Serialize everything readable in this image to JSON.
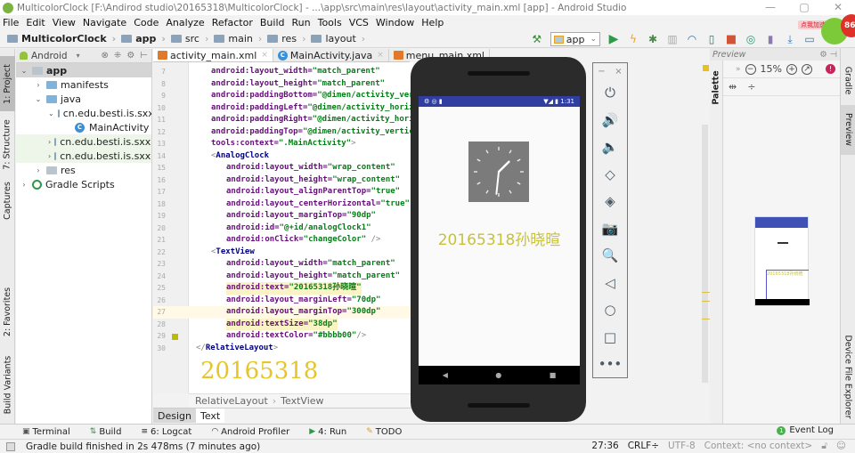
{
  "window": {
    "title": "MulticolorClock [F:\\Andirod studio\\20165318\\MulticolorClock] - ...\\app\\src\\main\\res\\layout\\activity_main.xml [app] - Android Studio",
    "controls": [
      "—",
      "▢",
      "✕"
    ]
  },
  "menu": [
    "File",
    "Edit",
    "View",
    "Navigate",
    "Code",
    "Analyze",
    "Refactor",
    "Build",
    "Run",
    "Tools",
    "VCS",
    "Window",
    "Help"
  ],
  "breadcrumb": [
    "MulticolorClock",
    "app",
    "src",
    "main",
    "res",
    "layout"
  ],
  "toolbar": {
    "run_config": "app",
    "speed_tag": "点我加速",
    "badge": "86",
    "icons": [
      "hammer-icon",
      "run-icon",
      "apply-changes-icon",
      "debug-icon",
      "attach-icon",
      "profiler-icon",
      "attach-debugger-icon",
      "stop-icon",
      "sync-icon",
      "avd-manager-icon",
      "sdk-manager-icon",
      "device-icon"
    ]
  },
  "left_strip": {
    "tabs": [
      "1: Project",
      "7: Structure",
      "Captures",
      "2: Favorites",
      "Build Variants"
    ]
  },
  "project": {
    "view_mode": "Android",
    "tree": [
      {
        "label": "app",
        "level": 0,
        "expanded": true,
        "type": "module",
        "selected": true
      },
      {
        "label": "manifests",
        "level": 1,
        "expanded": false,
        "type": "folder"
      },
      {
        "label": "java",
        "level": 1,
        "expanded": true,
        "type": "folder"
      },
      {
        "label": "cn.edu.besti.is.sxx.mu",
        "level": 2,
        "expanded": true,
        "type": "package"
      },
      {
        "label": "MainActivity",
        "level": 3,
        "type": "class"
      },
      {
        "label": "cn.edu.besti.is.sxx.mu",
        "level": 2,
        "expanded": false,
        "type": "package",
        "highlight": true
      },
      {
        "label": "cn.edu.besti.is.sxx.mu",
        "level": 2,
        "expanded": false,
        "type": "package",
        "highlight": true
      },
      {
        "label": "res",
        "level": 1,
        "expanded": false,
        "type": "res"
      },
      {
        "label": "Gradle Scripts",
        "level": 0,
        "expanded": false,
        "type": "gradle"
      }
    ]
  },
  "editor": {
    "tabs": [
      {
        "label": "activity_main.xml",
        "icon": "xml",
        "active": true
      },
      {
        "label": "MainActivity.java",
        "icon": "class",
        "active": false
      },
      {
        "label": "menu_main.xml",
        "icon": "xml",
        "active": false
      }
    ],
    "lines": [
      {
        "n": "7",
        "indent": 1,
        "parts": [
          [
            "attr",
            "android:layout_width="
          ],
          [
            "val",
            "\"match_parent\""
          ]
        ]
      },
      {
        "n": "8",
        "indent": 1,
        "parts": [
          [
            "attr",
            "android:layout_height="
          ],
          [
            "val",
            "\"match_parent\""
          ]
        ]
      },
      {
        "n": "9",
        "indent": 1,
        "parts": [
          [
            "attr",
            "android:paddingBottom="
          ],
          [
            "val",
            "\"@dimen/activity_vertic"
          ]
        ]
      },
      {
        "n": "10",
        "indent": 1,
        "parts": [
          [
            "attr",
            "android:paddingLeft="
          ],
          [
            "val",
            "\"@dimen/activity_horizont"
          ]
        ]
      },
      {
        "n": "11",
        "indent": 1,
        "parts": [
          [
            "attr",
            "android:paddingRight="
          ],
          [
            "val",
            "\"@dimen/activity_horizon"
          ]
        ]
      },
      {
        "n": "12",
        "indent": 1,
        "parts": [
          [
            "attr",
            "android:paddingTop="
          ],
          [
            "val",
            "\"@dimen/activity_vertical_"
          ]
        ]
      },
      {
        "n": "13",
        "indent": 1,
        "parts": [
          [
            "attr",
            "tools:context="
          ],
          [
            "val",
            "\".MainActivity\""
          ],
          [
            "plain",
            ">"
          ]
        ]
      },
      {
        "n": "14",
        "indent": 1,
        "parts": [
          [
            "plain",
            "<"
          ],
          [
            "tag",
            "AnalogClock"
          ]
        ]
      },
      {
        "n": "15",
        "indent": 2,
        "parts": [
          [
            "attr",
            "android:layout_width="
          ],
          [
            "val",
            "\"wrap_content\""
          ]
        ]
      },
      {
        "n": "16",
        "indent": 2,
        "parts": [
          [
            "attr",
            "android:layout_height="
          ],
          [
            "val",
            "\"wrap_content\""
          ]
        ]
      },
      {
        "n": "17",
        "indent": 2,
        "parts": [
          [
            "attr",
            "android:layout_alignParentTop="
          ],
          [
            "val",
            "\"true\""
          ]
        ]
      },
      {
        "n": "18",
        "indent": 2,
        "parts": [
          [
            "attr",
            "android:layout_centerHorizontal="
          ],
          [
            "val",
            "\"true\""
          ]
        ]
      },
      {
        "n": "19",
        "indent": 2,
        "parts": [
          [
            "attr",
            "android:layout_marginTop="
          ],
          [
            "val",
            "\"90dp\""
          ]
        ]
      },
      {
        "n": "20",
        "indent": 2,
        "parts": [
          [
            "attr",
            "android:id="
          ],
          [
            "val",
            "\"@+id/analogClock1\""
          ]
        ]
      },
      {
        "n": "21",
        "indent": 2,
        "parts": [
          [
            "attr",
            "android:onClick="
          ],
          [
            "val",
            "\"changeColor\""
          ],
          [
            "plain",
            " />"
          ]
        ]
      },
      {
        "n": "22",
        "indent": 1,
        "parts": [
          [
            "plain",
            "<"
          ],
          [
            "tag",
            "TextView"
          ]
        ]
      },
      {
        "n": "23",
        "indent": 2,
        "parts": [
          [
            "attr",
            "android:layout_width="
          ],
          [
            "val",
            "\"match_parent\""
          ]
        ]
      },
      {
        "n": "24",
        "indent": 2,
        "parts": [
          [
            "attr",
            "android:layout_height="
          ],
          [
            "val",
            "\"match_parent\""
          ]
        ]
      },
      {
        "n": "25",
        "indent": 2,
        "yellow": true,
        "parts": [
          [
            "attr",
            "android:text="
          ],
          [
            "val",
            "\"20165318孙晓暄\""
          ]
        ]
      },
      {
        "n": "26",
        "indent": 2,
        "parts": [
          [
            "attr",
            "android:layout_marginLeft="
          ],
          [
            "val",
            "\"70dp\""
          ]
        ]
      },
      {
        "n": "27",
        "indent": 2,
        "caret": true,
        "parts": [
          [
            "attr",
            "android:layout_marginTop="
          ],
          [
            "val",
            "\"300dp\""
          ]
        ]
      },
      {
        "n": "28",
        "indent": 2,
        "yellow": true,
        "parts": [
          [
            "attr",
            "android:textSize="
          ],
          [
            "val",
            "\"38dp\""
          ]
        ]
      },
      {
        "n": "29",
        "indent": 2,
        "parts": [
          [
            "attr",
            "android:textColor="
          ],
          [
            "val",
            "\"#bbbb00\""
          ],
          [
            "plain",
            "/>"
          ]
        ]
      },
      {
        "n": "30",
        "indent": 0,
        "parts": [
          [
            "plain",
            "</"
          ],
          [
            "tag",
            "RelativeLayout"
          ],
          [
            "plain",
            ">"
          ]
        ]
      }
    ],
    "inline_preview_text": "20165318",
    "structure_breadcrumb": [
      "RelativeLayout",
      "TextView"
    ],
    "mode_tabs": [
      "Design",
      "Text"
    ],
    "active_mode": "Text",
    "gutter_color": "#bbbb00"
  },
  "emulator": {
    "status_time": "1:31",
    "app_text": "20165318孙晓暄",
    "text_color": "#c7c23a",
    "clock": {
      "hour": 1,
      "minute": 31
    },
    "side_controls": [
      {
        "name": "power-icon",
        "glyph": "⏻"
      },
      {
        "name": "volume-up-icon",
        "glyph": "🔊"
      },
      {
        "name": "volume-down-icon",
        "glyph": "🔈"
      },
      {
        "name": "rotate-left-icon",
        "glyph": "◇"
      },
      {
        "name": "rotate-right-icon",
        "glyph": "◈"
      },
      {
        "name": "camera-icon",
        "glyph": "📷"
      },
      {
        "name": "zoom-icon",
        "glyph": "🔍"
      },
      {
        "name": "back-icon",
        "glyph": "◁"
      },
      {
        "name": "home-icon",
        "glyph": "○"
      },
      {
        "name": "overview-icon",
        "glyph": "□"
      },
      {
        "name": "more-icon",
        "glyph": "•••"
      }
    ],
    "window_controls": [
      "−",
      "×"
    ]
  },
  "preview": {
    "title": "Preview",
    "zoom": "15%",
    "palette_label": "Palette"
  },
  "right_strip": {
    "tabs": [
      "Gradle",
      "Preview",
      "Device File Explorer"
    ]
  },
  "tool_windows": [
    {
      "label": "Terminal",
      "icon": "terminal-icon"
    },
    {
      "label": "Build",
      "icon": "build-icon"
    },
    {
      "label": "6: Logcat",
      "icon": "logcat-icon"
    },
    {
      "label": "Android Profiler",
      "icon": "profiler-icon"
    },
    {
      "label": "4: Run",
      "icon": "run-icon"
    },
    {
      "label": "TODO",
      "icon": "todo-icon"
    }
  ],
  "event_log": {
    "label": "Event Log",
    "count": "1"
  },
  "status": {
    "message": "Gradle build finished in 2s 478ms (7 minutes ago)",
    "position": "27:36",
    "line_sep": "CRLF÷",
    "encoding": "UTF-8",
    "context": "Context: <no context>"
  }
}
